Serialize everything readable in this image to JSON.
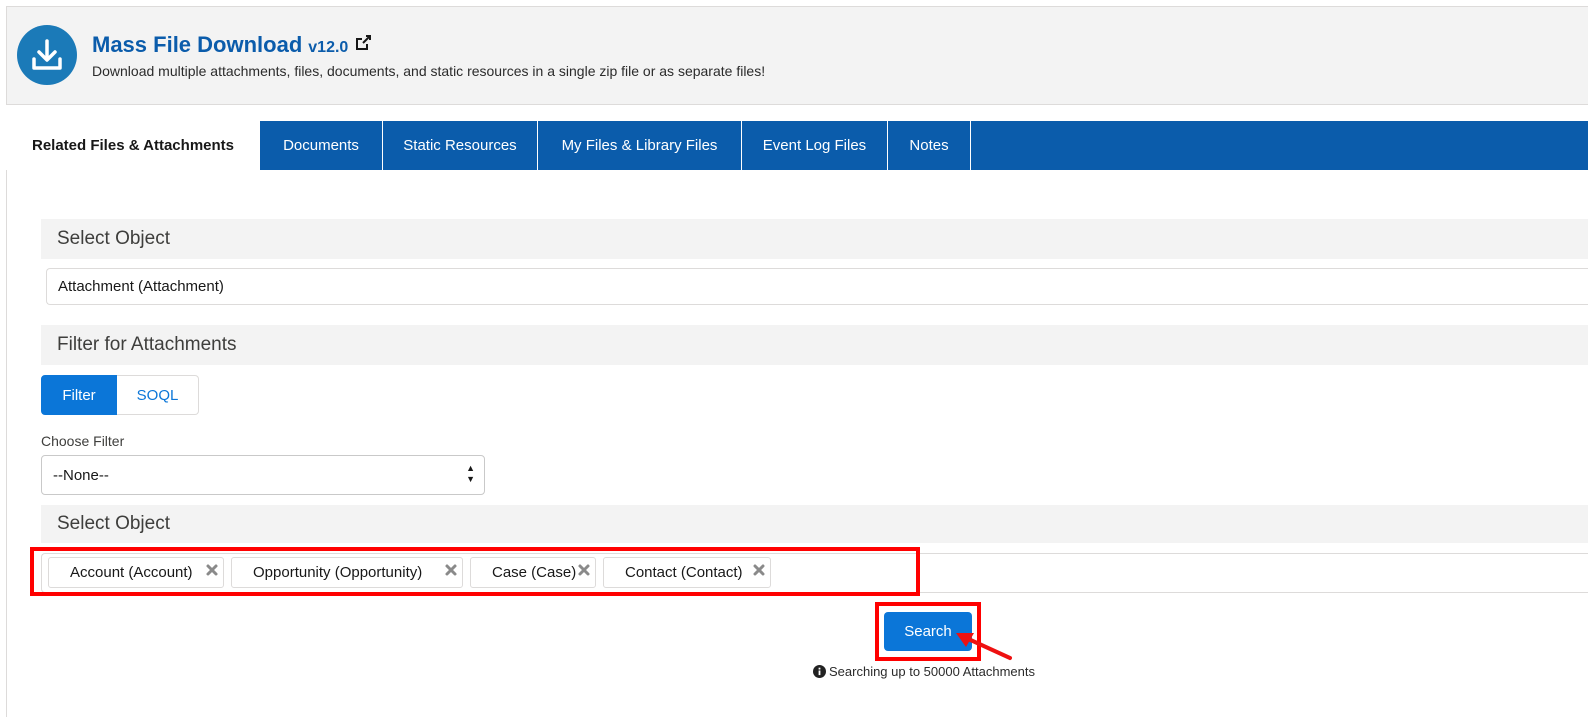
{
  "header": {
    "title": "Mass File Download",
    "version": "v12.0",
    "subtitle": "Download multiple attachments, files, documents, and static resources in a single zip file or as separate files!",
    "logo_icon": "download-icon",
    "external_link_icon": "external-link-icon"
  },
  "tabs": [
    {
      "label": "Related Files & Attachments",
      "active": true
    },
    {
      "label": "Documents",
      "active": false
    },
    {
      "label": "Static Resources",
      "active": false
    },
    {
      "label": "My Files & Library Files",
      "active": false
    },
    {
      "label": "Event Log Files",
      "active": false
    },
    {
      "label": "Notes",
      "active": false
    }
  ],
  "select_object_section": {
    "heading": "Select Object",
    "value": "Attachment (Attachment)"
  },
  "filter_section": {
    "heading": "Filter for Attachments",
    "modes": [
      {
        "label": "Filter",
        "selected": true
      },
      {
        "label": "SOQL",
        "selected": false
      }
    ],
    "choose_filter_label": "Choose Filter",
    "choose_filter_value": "--None--"
  },
  "related_objects_section": {
    "heading": "Select Object",
    "pills": [
      {
        "label": "Account (Account)"
      },
      {
        "label": "Opportunity (Opportunity)"
      },
      {
        "label": "Case (Case)"
      },
      {
        "label": "Contact (Contact)"
      }
    ],
    "remove_icon": "close-icon"
  },
  "search": {
    "button_label": "Search",
    "note": "Searching up to 50000 Attachments",
    "note_icon": "info-icon"
  },
  "colors": {
    "brand_blue": "#0b5cab",
    "button_blue": "#0b76d8",
    "highlight_red": "#ff0000"
  }
}
